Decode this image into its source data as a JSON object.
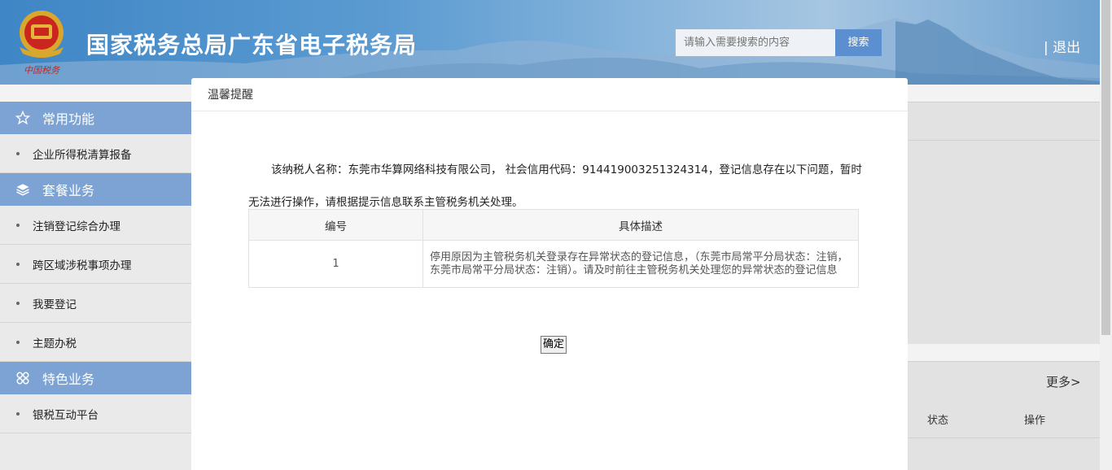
{
  "header": {
    "emblem_text": "中国税务",
    "title": "国家税务总局广东省电子税务局",
    "search_placeholder": "请输入需要搜索的内容",
    "search_button": "搜索",
    "logout": "| 退出"
  },
  "sidebar": {
    "sections": [
      {
        "title": "常用功能",
        "icon": "star-icon",
        "items": [
          "企业所得税清算报备"
        ]
      },
      {
        "title": "套餐业务",
        "icon": "layers-icon",
        "items": [
          "注销登记综合办理",
          "跨区域涉税事项办理",
          "我要登记",
          "主题办税"
        ]
      },
      {
        "title": "特色业务",
        "icon": "grid-icon",
        "items": [
          "银税互动平台"
        ]
      }
    ]
  },
  "background": {
    "more_link": "更多>",
    "col_status": "状态",
    "col_operation": "操作"
  },
  "modal": {
    "title": "温馨提醒",
    "message": "该纳税人名称：东莞市华算网络科技有限公司， 社会信用代码：91441900325132431​4，登记信息存在以下问题，暂时无法进行操作，请根据提示信息联系主管税务机关处理。",
    "table": {
      "headers": [
        "编号",
        "具体描述"
      ],
      "rows": [
        {
          "no": "1",
          "desc": "停用原因为主管税务机关登录存在异常状态的登记信息，（东莞市局常平分局状态：注销，东莞市局常平分局状态：注销）。请及时前往主管税务机关处理您的异常状态的登记信息"
        }
      ]
    },
    "ok_button": "确定"
  },
  "colors": {
    "header_blue": "#3f86c6",
    "sidebar_section": "#7ca3d4",
    "search_button": "#5b8fd0"
  }
}
